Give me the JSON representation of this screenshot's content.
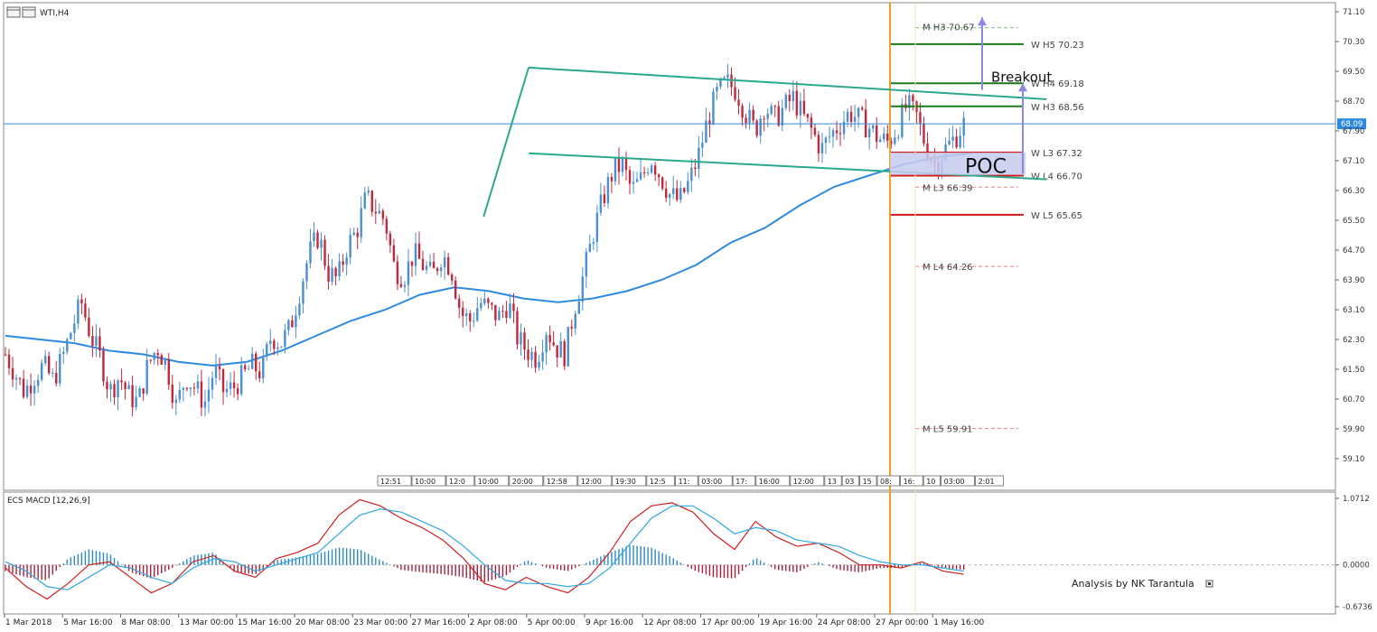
{
  "window": {
    "symbol_label": "WTI,H4"
  },
  "colors": {
    "bull": "#4a8fd0",
    "bear": "#c0283c",
    "ma": "#2e8ae0",
    "bid": "#2e8ae0",
    "channel": "#2aa88c",
    "pivot_green": "#1a7a1a",
    "pivot_red": "#d01818",
    "vline": "#f0a020",
    "arrow": "#8a8ae6",
    "poc_box": "#c7cbf0",
    "macd_main": "#d02020",
    "macd_signal": "#30a8e0",
    "hist_pos": "#2a8ac0",
    "hist_neg": "#a8203a"
  },
  "chart_data": [
    {
      "type": "candlestick",
      "title": "",
      "symbol": "WTI",
      "timeframe": "H4",
      "ylim": [
        58.7,
        71.3
      ],
      "y_ticks": [
        "71.10",
        "70.30",
        "69.50",
        "68.70",
        "67.90",
        "67.10",
        "66.30",
        "65.50",
        "64.70",
        "63.90",
        "63.10",
        "62.30",
        "61.50",
        "60.70",
        "59.90",
        "59.10"
      ],
      "y_tick_values": [
        71.1,
        70.3,
        69.5,
        68.7,
        67.9,
        67.1,
        66.3,
        65.5,
        64.7,
        63.9,
        63.1,
        62.3,
        61.5,
        60.7,
        59.9,
        59.1
      ],
      "bid_price": 68.09,
      "bid_label": "68.09",
      "x_ticks": [
        "1 Mar 2018",
        "5 Mar 16:00",
        "8 Mar 08:00",
        "13 Mar 00:00",
        "15 Mar 16:00",
        "20 Mar 08:00",
        "23 Mar 00:00",
        "27 Mar 16:00",
        "2 Apr 08:00",
        "5 Apr 00:00",
        "9 Apr 16:00",
        "12 Apr 08:00",
        "17 Apr 00:00",
        "19 Apr 16:00",
        "24 Apr 08:00",
        "27 Apr 00:00",
        "1 May 16:00"
      ],
      "close_path": [
        61.9,
        61.4,
        60.9,
        61.3,
        61.6,
        61.2,
        61.8,
        62.6,
        63.3,
        62.4,
        61.8,
        60.9,
        61.3,
        60.8,
        60.6,
        61.6,
        62.1,
        61.6,
        60.5,
        61.3,
        61.0,
        60.6,
        61.5,
        60.9,
        61.0,
        61.3,
        61.6,
        61.4,
        62.4,
        62.2,
        62.6,
        63.6,
        64.6,
        65.1,
        64.1,
        63.9,
        64.8,
        65.2,
        66.1,
        65.8,
        65.5,
        64.2,
        64.0,
        64.6,
        64.3,
        64.0,
        64.6,
        64.2,
        63.0,
        62.8,
        63.3,
        63.1,
        62.9,
        63.3,
        62.3,
        62.0,
        61.8,
        62.6,
        62.1,
        61.9,
        63.2,
        64.1,
        65.2,
        66.1,
        66.8,
        67.0,
        66.3,
        66.6,
        67.2,
        66.7,
        66.2,
        66.0,
        66.5,
        67.2,
        68.2,
        68.9,
        69.2,
        69.0,
        68.4,
        67.9,
        68.6,
        68.2,
        68.5,
        68.8,
        68.3,
        67.9,
        67.4,
        67.8,
        68.1,
        68.4,
        68.2,
        68.0,
        67.7,
        67.6,
        68.0,
        68.6,
        68.3,
        67.5,
        67.0,
        67.4,
        67.7,
        68.09
      ],
      "moving_average_path": [
        62.4,
        62.3,
        62.2,
        62.0,
        61.9,
        61.7,
        61.6,
        61.7,
        62.0,
        62.4,
        62.8,
        63.1,
        63.5,
        63.7,
        63.6,
        63.4,
        63.3,
        63.4,
        63.6,
        63.9,
        64.3,
        64.9,
        65.3,
        65.9,
        66.4,
        66.7,
        67.0,
        67.2,
        67.3
      ],
      "channel": {
        "upper": [
          [
            0.5,
            69.6
          ],
          [
            0.995,
            68.75
          ]
        ],
        "lower": [
          [
            0.5,
            67.3
          ],
          [
            0.995,
            66.6
          ]
        ],
        "impulse": [
          [
            0.457,
            65.6
          ],
          [
            0.5,
            69.6
          ]
        ]
      },
      "pivot_levels": [
        {
          "label": "M  H3 70.67",
          "value": 70.67,
          "kind": "monthly",
          "color": "green"
        },
        {
          "label": "W  H5 70.23",
          "value": 70.23,
          "kind": "weekly",
          "color": "green"
        },
        {
          "label": "W  H4 69.18",
          "value": 69.18,
          "kind": "weekly",
          "color": "green"
        },
        {
          "label": "W  H3 68.56",
          "value": 68.56,
          "kind": "weekly",
          "color": "green"
        },
        {
          "label": "W  L3 67.32",
          "value": 67.32,
          "kind": "weekly",
          "color": "red"
        },
        {
          "label": "W  L4 66.70",
          "value": 66.7,
          "kind": "weekly",
          "color": "red"
        },
        {
          "label": "M  L3 66.39",
          "value": 66.39,
          "kind": "monthly",
          "color": "red"
        },
        {
          "label": "W  L5 65.65",
          "value": 65.65,
          "kind": "weekly",
          "color": "red"
        },
        {
          "label": "M  L4 64.26",
          "value": 64.26,
          "kind": "monthly",
          "color": "red"
        },
        {
          "label": "M  L5 59.91",
          "value": 59.91,
          "kind": "monthly",
          "color": "red"
        }
      ],
      "poc_zone": {
        "label": "POC",
        "low": 66.72,
        "high": 67.32
      },
      "annotations": [
        {
          "text": "Breakout"
        }
      ],
      "session_ticks": [
        "12:51",
        "10:00",
        "12:0",
        "10:00",
        "20:00",
        "12:58",
        "12:00",
        "19:30",
        "12:5",
        "11:",
        "03:00",
        "17:",
        "16:00",
        "12:00",
        "13",
        "03",
        "15",
        "08:",
        "16:",
        "10",
        "03:00",
        "2:01"
      ]
    },
    {
      "type": "line",
      "title": "ECS MACD [12,26,9]",
      "params": [
        12,
        26,
        9
      ],
      "ylim": [
        -0.6736,
        1.0712
      ],
      "y_ticks": [
        "1.0712",
        "0.0000",
        "-0.6736"
      ],
      "series": [
        {
          "name": "MACD",
          "values": [
            -0.05,
            -0.35,
            -0.55,
            -0.3,
            0.0,
            0.05,
            -0.2,
            -0.45,
            -0.3,
            0.05,
            0.15,
            -0.1,
            -0.2,
            0.1,
            0.2,
            0.35,
            0.8,
            1.05,
            0.95,
            0.75,
            0.6,
            0.4,
            0.1,
            -0.3,
            -0.4,
            -0.2,
            -0.35,
            -0.45,
            -0.2,
            0.2,
            0.7,
            0.95,
            1.0,
            0.85,
            0.5,
            0.25,
            0.7,
            0.45,
            0.3,
            0.35,
            0.2,
            0.0,
            0.0,
            -0.05,
            0.05,
            -0.1,
            -0.15
          ]
        },
        {
          "name": "Signal",
          "values": [
            0.05,
            -0.1,
            -0.35,
            -0.4,
            -0.2,
            0.0,
            -0.05,
            -0.2,
            -0.3,
            -0.05,
            0.1,
            0.05,
            -0.1,
            0.0,
            0.1,
            0.2,
            0.5,
            0.8,
            0.9,
            0.85,
            0.7,
            0.55,
            0.3,
            0.0,
            -0.25,
            -0.3,
            -0.3,
            -0.35,
            -0.3,
            -0.05,
            0.35,
            0.75,
            0.95,
            0.95,
            0.75,
            0.5,
            0.6,
            0.55,
            0.4,
            0.35,
            0.3,
            0.15,
            0.05,
            0.0,
            0.0,
            -0.05,
            -0.1
          ]
        },
        {
          "name": "Histogram",
          "values": [
            -0.1,
            -0.2,
            -0.25,
            0.1,
            0.25,
            0.18,
            -0.12,
            -0.22,
            -0.05,
            0.15,
            0.2,
            -0.12,
            -0.15,
            0.08,
            0.12,
            0.18,
            0.28,
            0.25,
            0.08,
            -0.08,
            -0.12,
            -0.15,
            -0.2,
            -0.28,
            -0.18,
            0.08,
            -0.05,
            -0.1,
            0.05,
            0.2,
            0.32,
            0.28,
            0.12,
            -0.08,
            -0.2,
            -0.22,
            0.12,
            -0.08,
            -0.12,
            0.05,
            -0.08,
            -0.12,
            -0.05,
            -0.05,
            0.05,
            -0.05,
            -0.08
          ]
        }
      ],
      "credit": "Analysis by NK Tarantula"
    }
  ]
}
